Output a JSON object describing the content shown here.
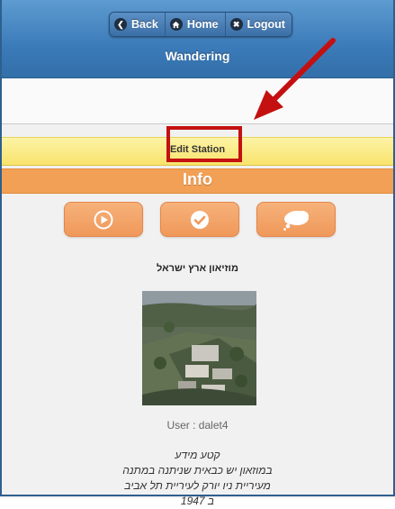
{
  "header": {
    "buttons": {
      "back": "Back",
      "home": "Home",
      "logout": "Logout"
    },
    "title": "Wandering"
  },
  "edit_station": {
    "label": "Edit Station"
  },
  "info": {
    "title": "Info",
    "actions": [
      {
        "icon": "play-icon"
      },
      {
        "icon": "check-icon"
      },
      {
        "icon": "cloud-icon"
      }
    ]
  },
  "station": {
    "name": "מוזיאון ארץ ישראל",
    "user_line": "User : dalet4",
    "desc_lines": [
      "קטע מידע",
      "במוזאון יש כבאית שניתנה במתנה",
      "מעיריית ניו יורק לעיריית תל אביב",
      "ב 1947"
    ]
  },
  "colors": {
    "header_blue": "#3b7bb9",
    "yellow_bar": "#f8e36b",
    "info_orange": "#f2a055",
    "highlight_red": "#c41010"
  }
}
